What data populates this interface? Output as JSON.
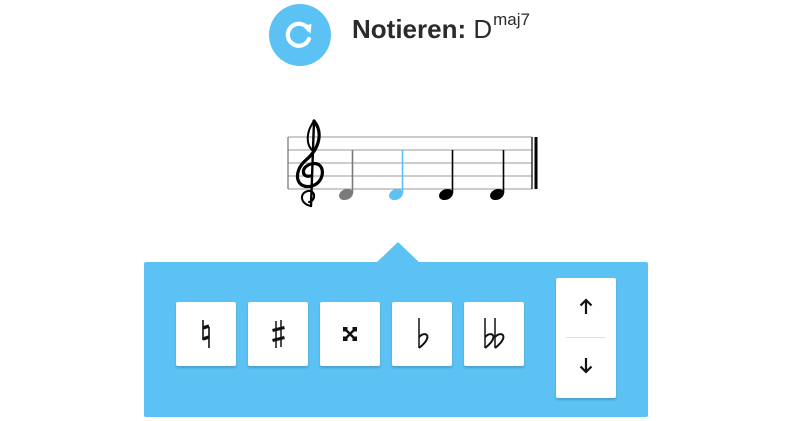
{
  "header": {
    "title_prefix": "Notieren:",
    "chord_root": "D",
    "chord_quality": "maj7",
    "reload_icon": "reload-icon"
  },
  "staff": {
    "clef": "treble-clef",
    "notes": [
      {
        "state": "entered",
        "color": "#7a7a7a"
      },
      {
        "state": "active",
        "color": "#5bc2f3"
      },
      {
        "state": "pending",
        "color": "#000000"
      },
      {
        "state": "pending",
        "color": "#000000"
      }
    ]
  },
  "accidentals": [
    {
      "name": "natural",
      "icon": "natural-icon"
    },
    {
      "name": "sharp",
      "icon": "sharp-icon"
    },
    {
      "name": "double-sharp",
      "icon": "double-sharp-icon"
    },
    {
      "name": "flat",
      "icon": "flat-icon"
    },
    {
      "name": "double-flat",
      "icon": "double-flat-icon"
    }
  ],
  "octave": {
    "up_icon": "arrow-up-icon",
    "down_icon": "arrow-down-icon"
  },
  "colors": {
    "accent": "#5bc2f3",
    "text": "#2b2b2b",
    "entered_note": "#7a7a7a",
    "active_note": "#5bc2f3"
  }
}
